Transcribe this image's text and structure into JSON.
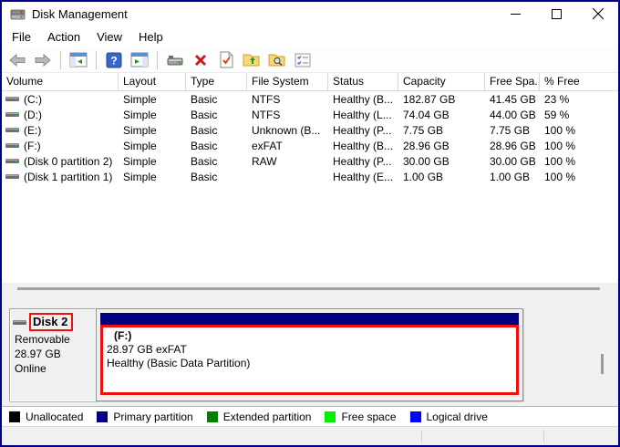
{
  "window": {
    "title": "Disk Management"
  },
  "menu": {
    "items": [
      "File",
      "Action",
      "View",
      "Help"
    ]
  },
  "table": {
    "columns": [
      "Volume",
      "Layout",
      "Type",
      "File System",
      "Status",
      "Capacity",
      "Free Spa...",
      "% Free"
    ],
    "rows": [
      {
        "volume": "(C:)",
        "layout": "Simple",
        "type": "Basic",
        "fs": "NTFS",
        "status": "Healthy (B...",
        "capacity": "182.87 GB",
        "free": "41.45 GB",
        "pct": "23 %"
      },
      {
        "volume": "(D:)",
        "layout": "Simple",
        "type": "Basic",
        "fs": "NTFS",
        "status": "Healthy (L...",
        "capacity": "74.04 GB",
        "free": "44.00 GB",
        "pct": "59 %"
      },
      {
        "volume": "(E:)",
        "layout": "Simple",
        "type": "Basic",
        "fs": "Unknown (B...",
        "status": "Healthy (P...",
        "capacity": "7.75 GB",
        "free": "7.75 GB",
        "pct": "100 %"
      },
      {
        "volume": "(F:)",
        "layout": "Simple",
        "type": "Basic",
        "fs": "exFAT",
        "status": "Healthy (B...",
        "capacity": "28.96 GB",
        "free": "28.96 GB",
        "pct": "100 %"
      },
      {
        "volume": "(Disk 0 partition 2)",
        "layout": "Simple",
        "type": "Basic",
        "fs": "RAW",
        "status": "Healthy (P...",
        "capacity": "30.00 GB",
        "free": "30.00 GB",
        "pct": "100 %"
      },
      {
        "volume": "(Disk 1 partition 1)",
        "layout": "Simple",
        "type": "Basic",
        "fs": "",
        "status": "Healthy (E...",
        "capacity": "1.00 GB",
        "free": "1.00 GB",
        "pct": "100 %"
      }
    ]
  },
  "disk": {
    "name": "Disk 2",
    "media": "Removable",
    "size": "28.97 GB",
    "state": "Online",
    "partition": {
      "title": "(F:)",
      "size_fs": "28.97 GB exFAT",
      "health": "Healthy (Basic Data Partition)"
    }
  },
  "legend": {
    "items": [
      {
        "label": "Unallocated",
        "color": "#000000"
      },
      {
        "label": "Primary partition",
        "color": "#000080"
      },
      {
        "label": "Extended partition",
        "color": "#008000"
      },
      {
        "label": "Free space",
        "color": "#00f000"
      },
      {
        "label": "Logical drive",
        "color": "#0000ff"
      }
    ]
  },
  "colors": {
    "primary_partition_bar": "#000080",
    "annotation_red": "#ee0f0f",
    "window_border": "#00008b"
  }
}
